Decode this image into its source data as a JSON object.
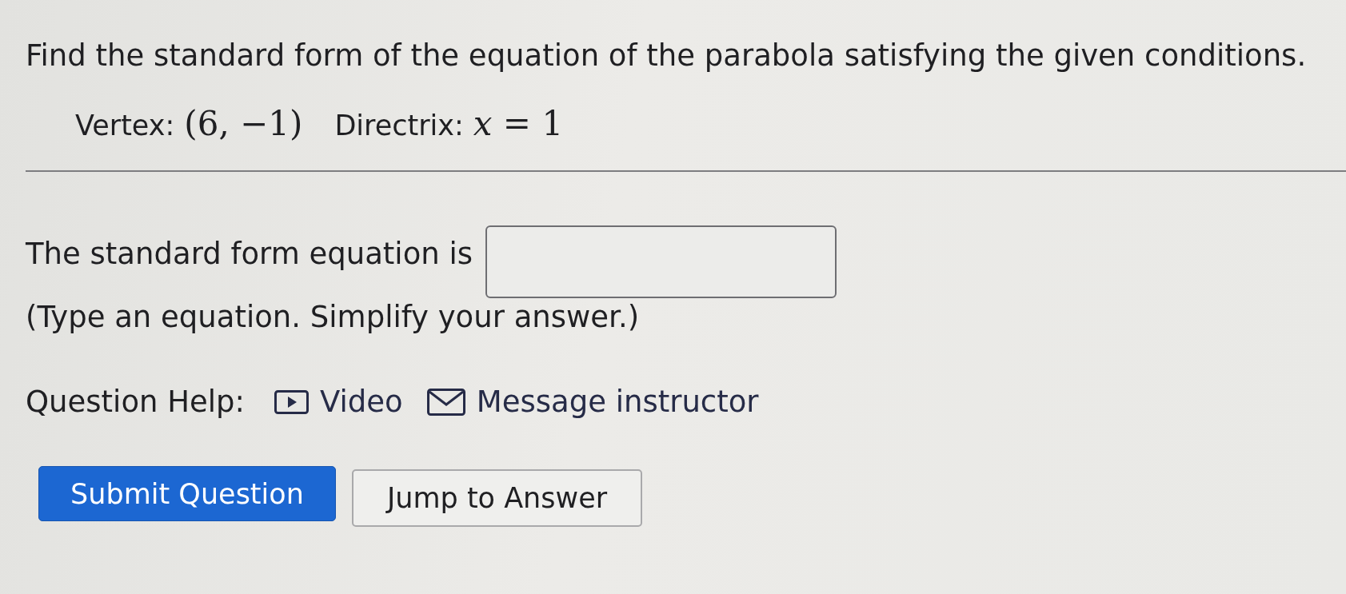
{
  "question": {
    "prompt": "Find the standard form of the equation of the parabola satisfying the given conditions.",
    "conditions": [
      {
        "label": "Vertex:",
        "value": "(6, −1)"
      },
      {
        "label": "Directrix:",
        "value": "*x* = 1"
      }
    ]
  },
  "answer": {
    "label": "The standard form equation is",
    "hint": "(Type an equation. Simplify your answer.)"
  },
  "help": {
    "label": "Question Help:",
    "links": [
      {
        "kind": "video",
        "label": "Video"
      },
      {
        "kind": "message",
        "label": "Message instructor"
      }
    ]
  },
  "buttons": [
    {
      "kind": "primary",
      "label": "Submit Question"
    },
    {
      "kind": "secondary",
      "label": "Jump to Answer"
    }
  ]
}
